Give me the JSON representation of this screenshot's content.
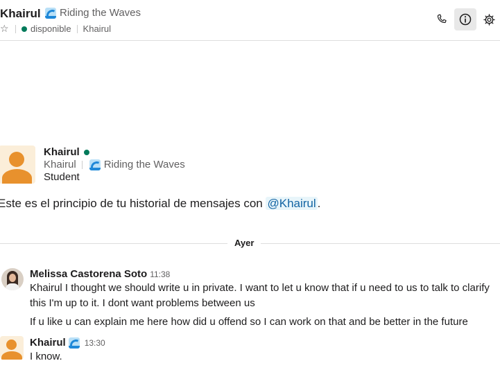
{
  "header": {
    "name": "Khairul",
    "status_text": "Riding the Waves",
    "presence": "disponible",
    "display_name": "Khairul"
  },
  "intro": {
    "name": "Khairul",
    "display_name": "Khairul",
    "status_text": "Riding the Waves",
    "title": "Student",
    "history_prefix": "Este es el principio de tu historial de mensajes con ",
    "history_mention": "@Khairul",
    "history_suffix": "."
  },
  "divider": {
    "label": "Ayer"
  },
  "messages": [
    {
      "author": "Melissa Castorena Soto",
      "time": "11:38",
      "lines": [
        "Khairul I thought we should write u in private. I want to let u know that if u need to us to talk to clarify this I'm up to it. I dont want problems between us",
        "If u like u can explain me here how did u offend so I can work on that and be better in the future"
      ]
    },
    {
      "author": "Khairul",
      "time": "13:30",
      "lines": [
        "I know."
      ]
    }
  ],
  "colors": {
    "presence": "#007a5a",
    "mention_text": "#1264a3",
    "mention_bg": "#e8f5fa",
    "avatar_orange": "#e8912d"
  },
  "icons": [
    "star-icon",
    "phone-icon",
    "info-icon",
    "gear-icon",
    "wave-emoji-icon"
  ]
}
